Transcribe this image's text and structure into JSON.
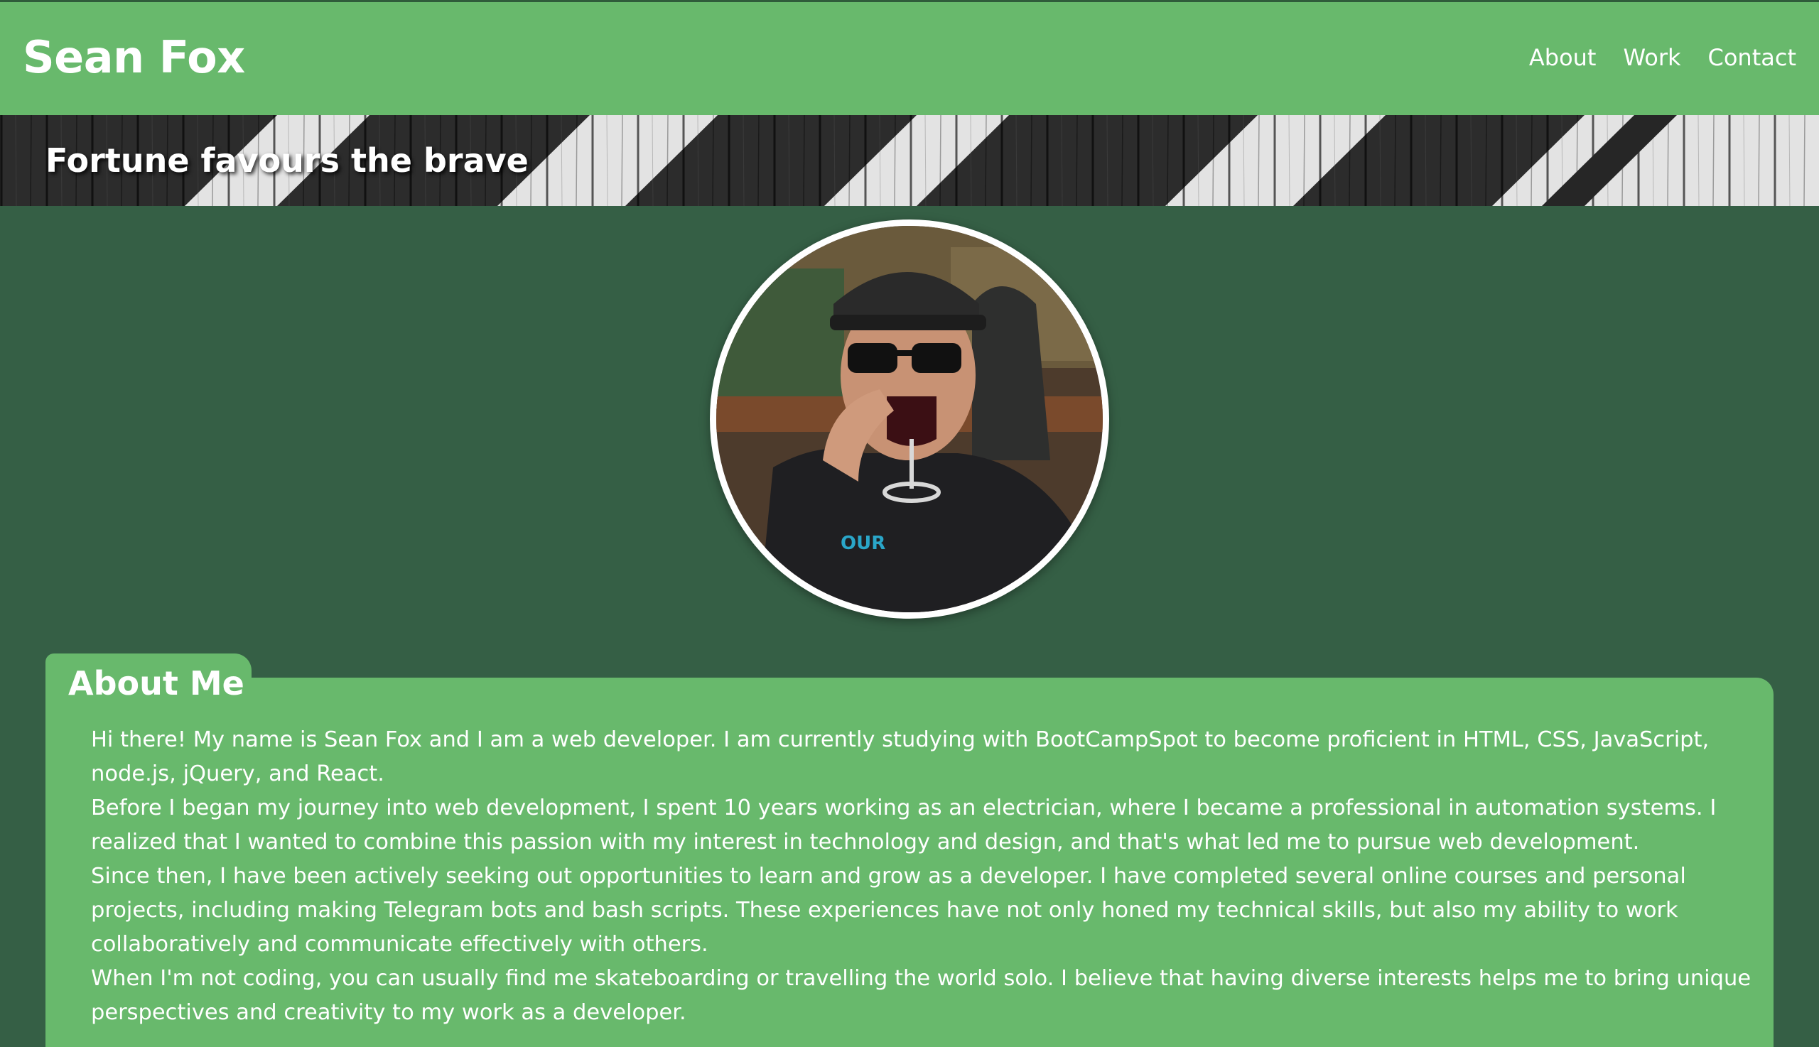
{
  "header": {
    "site_title": "Sean Fox",
    "nav": [
      {
        "label": "About"
      },
      {
        "label": "Work"
      },
      {
        "label": "Contact"
      }
    ]
  },
  "hero": {
    "tagline": "Fortune favours the brave"
  },
  "profile": {
    "image_alt": "Sean Fox drinking from a wine glass"
  },
  "about": {
    "heading": "About Me",
    "paragraphs": [
      "Hi there! My name is Sean Fox and I am a web developer. I am currently studying with BootCampSpot to become proficient in HTML, CSS, JavaScript, node.js, jQuery, and React.",
      "Before I began my journey into web development, I spent 10 years working as an electrician, where I became a professional in automation systems. I realized that I wanted to combine this passion with my interest in technology and design, and that's what led me to pursue web development.",
      "Since then, I have been actively seeking out opportunities to learn and grow as a developer. I have completed several online courses and personal projects, including making Telegram bots and bash scripts. These experiences have not only honed my technical skills, but also my ability to work collaboratively and communicate effectively with others.",
      "When I'm not coding, you can usually find me skateboarding or travelling the world solo. I believe that having diverse interests helps me to bring unique perspectives and creativity to my work as a developer."
    ]
  },
  "colors": {
    "header_green": "#68b96c",
    "page_background": "#355f45",
    "text": "#ffffff"
  }
}
